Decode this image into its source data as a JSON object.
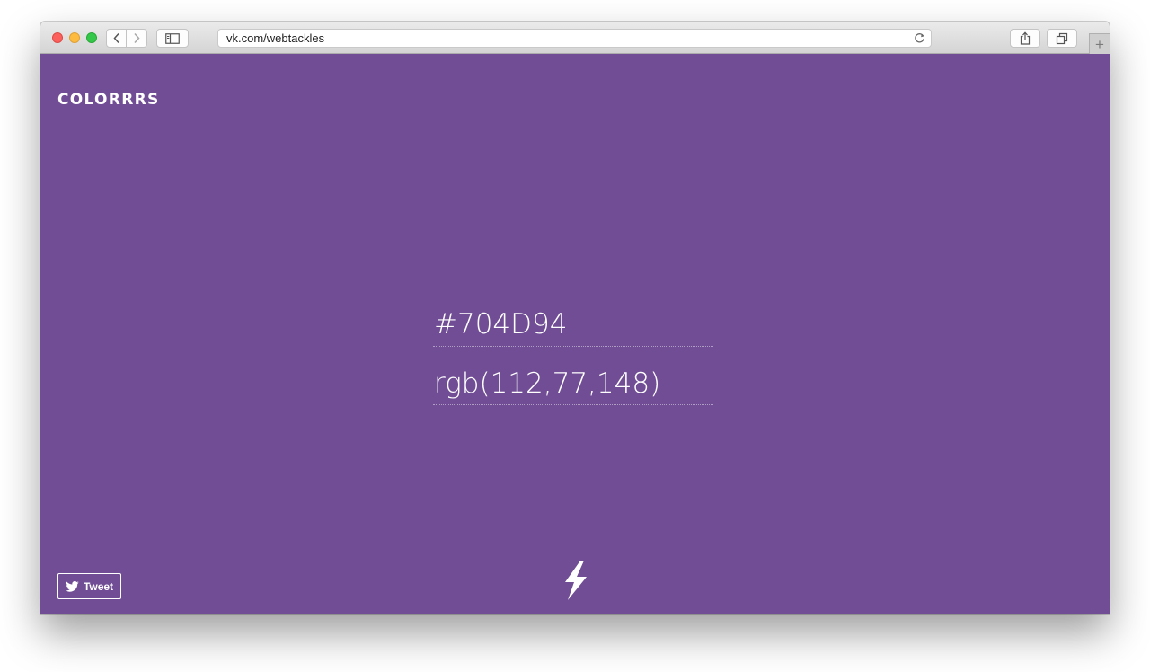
{
  "browser": {
    "address": "vk.com/webtackles",
    "new_tab_label": "+"
  },
  "page": {
    "logo": "COLORRRS",
    "hex": "#704D94",
    "rgb": "rgb(112,77,148)",
    "tweet_label": "Tweet",
    "background_color": "#704D94",
    "icons": [
      "twitter-bird-icon",
      "lightning-bolt-icon"
    ]
  }
}
